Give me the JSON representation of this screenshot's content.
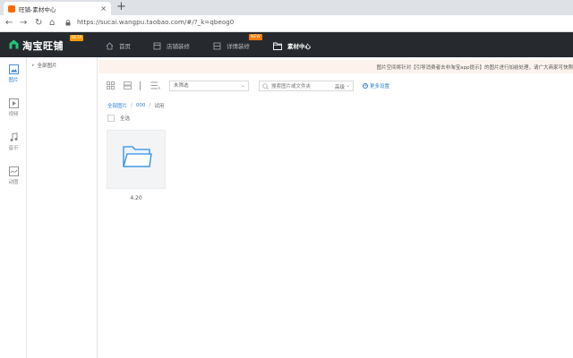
{
  "browser": {
    "tab_title": "旺铺-素材中心",
    "tab_close": "×",
    "new_tab": "+",
    "url": "https://sucai.wangpu.taobao.com/#/?_k=qbeog0"
  },
  "app": {
    "logo_text": "淘宝旺铺",
    "logo_badge": "BETA",
    "nav": [
      {
        "label": "首页",
        "icon": "home-icon"
      },
      {
        "label": "店铺装修",
        "icon": "shop-icon"
      },
      {
        "label": "详情装修",
        "icon": "detail-icon",
        "badge": "NEW"
      },
      {
        "label": "素材中心",
        "icon": "folder-icon",
        "active": true
      }
    ]
  },
  "rail": [
    {
      "label": "图片",
      "icon": "image-icon",
      "active": true
    },
    {
      "label": "视频",
      "icon": "video-icon"
    },
    {
      "label": "音乐",
      "icon": "music-icon"
    },
    {
      "label": "动图",
      "icon": "gif-icon"
    }
  ],
  "tree": {
    "root_label": "全部图片",
    "arrow": "▸"
  },
  "notice": {
    "text": "图片空间将针对【引导消费者去非淘宝app提示】的图片进行加结处理，请广大商家可快照"
  },
  "toolbar": {
    "filter_value": "未筛选",
    "search_placeholder": "搜索图片或文件夹",
    "advanced_label": "高级",
    "more_settings": "更多设置",
    "plus": "+"
  },
  "breadcrumb": {
    "items": [
      "全部图片",
      "000",
      "试用"
    ],
    "sep": "/"
  },
  "select_all_label": "全选",
  "folders": [
    {
      "name": "4.20"
    }
  ],
  "colors": {
    "header_bg": "#262a2f",
    "accent_blue": "#2f7fd6",
    "badge_orange": "#ff7a00",
    "notice_bg": "#fdf3ec"
  }
}
